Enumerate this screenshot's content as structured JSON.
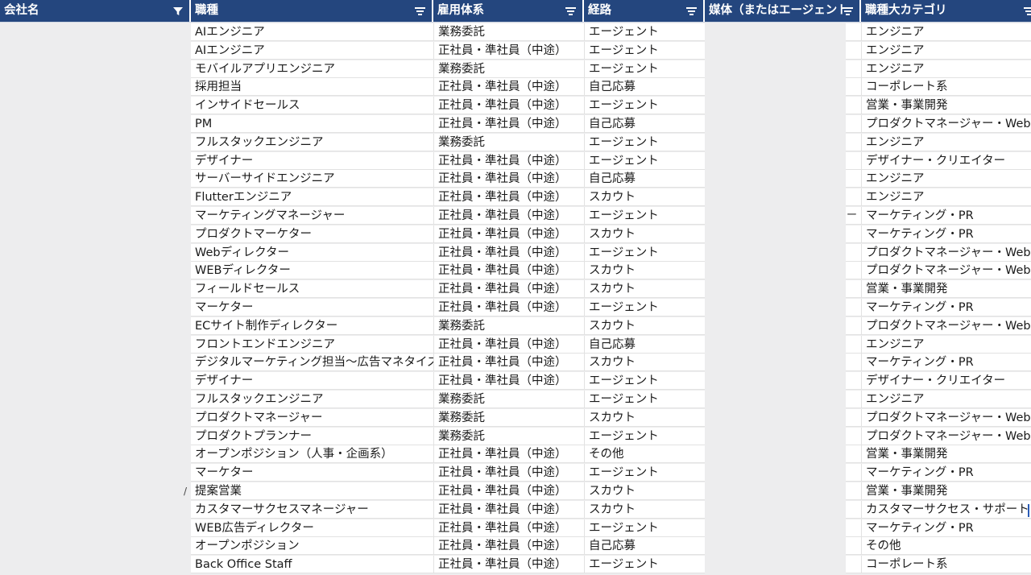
{
  "headers": [
    {
      "label": "会社名",
      "filter": "funnel-solid"
    },
    {
      "label": "職種",
      "filter": "lines"
    },
    {
      "label": "雇用体系",
      "filter": "lines"
    },
    {
      "label": "経路",
      "filter": "lines"
    },
    {
      "label": "媒体（またはエージェント",
      "filter": "lines"
    },
    {
      "label": "職種大カテゴリ",
      "filter": "lines"
    }
  ],
  "colors": {
    "header_bg": "#24467e",
    "header_text": "#ffffff",
    "cell_bg": "#ffffff",
    "grid": "#e2e2e2",
    "sheet_bg": "#ededee"
  },
  "rows": [
    {
      "role": "AIエンジニア",
      "employment": "業務委託",
      "route": "エージェント",
      "media": "",
      "category": "エンジニア"
    },
    {
      "role": "AIエンジニア",
      "employment": "正社員・準社員（中途）",
      "route": "エージェント",
      "media": "",
      "category": "エンジニア"
    },
    {
      "role": "モバイルアプリエンジニア",
      "employment": "業務委託",
      "route": "エージェント",
      "media": "",
      "category": "エンジニア"
    },
    {
      "role": "採用担当",
      "employment": "正社員・準社員（中途）",
      "route": "自己応募",
      "media": "",
      "category": "コーポレート系"
    },
    {
      "role": "インサイドセールス",
      "employment": "正社員・準社員（中途）",
      "route": "エージェント",
      "media": "",
      "category": "営業・事業開発"
    },
    {
      "role": "PM",
      "employment": "正社員・準社員（中途）",
      "route": "自己応募",
      "media": "",
      "category": "プロダクトマネージャー・Webデ"
    },
    {
      "role": "フルスタックエンジニア",
      "employment": "業務委託",
      "route": "エージェント",
      "media": "",
      "category": "エンジニア"
    },
    {
      "role": "デザイナー",
      "employment": "正社員・準社員（中途）",
      "route": "エージェント",
      "media": "",
      "category": "デザイナー・クリエイター"
    },
    {
      "role": "サーバーサイドエンジニア",
      "employment": "正社員・準社員（中途）",
      "route": "自己応募",
      "media": "",
      "category": "エンジニア"
    },
    {
      "role": "Flutterエンジニア",
      "employment": "正社員・準社員（中途）",
      "route": "スカウト",
      "media": "",
      "category": "エンジニア"
    },
    {
      "role": "マーケティングマネージャー",
      "employment": "正社員・準社員（中途）",
      "route": "エージェント",
      "media": "ー",
      "category": "マーケティング・PR"
    },
    {
      "role": "プロダクトマーケター",
      "employment": "正社員・準社員（中途）",
      "route": "スカウト",
      "media": "",
      "category": "マーケティング・PR"
    },
    {
      "role": "Webディレクター",
      "employment": "正社員・準社員（中途）",
      "route": "エージェント",
      "media": "",
      "category": "プロダクトマネージャー・Webデ"
    },
    {
      "role": "WEBディレクター",
      "employment": "正社員・準社員（中途）",
      "route": "スカウト",
      "media": "",
      "category": "プロダクトマネージャー・Webデ"
    },
    {
      "role": "フィールドセールス",
      "employment": "正社員・準社員（中途）",
      "route": "スカウト",
      "media": "",
      "category": "営業・事業開発"
    },
    {
      "role": "マーケター",
      "employment": "正社員・準社員（中途）",
      "route": "エージェント",
      "media": "",
      "category": "マーケティング・PR"
    },
    {
      "role": "ECサイト制作ディレクター",
      "employment": "業務委託",
      "route": "スカウト",
      "media": "",
      "category": "プロダクトマネージャー・Webデ"
    },
    {
      "role": "フロントエンドエンジニア",
      "employment": "正社員・準社員（中途）",
      "route": "自己応募",
      "media": "",
      "category": "エンジニア"
    },
    {
      "role": "デジタルマーケティング担当〜広告マネタイズ",
      "employment": "正社員・準社員（中途）",
      "route": "スカウト",
      "media": "",
      "category": "マーケティング・PR"
    },
    {
      "role": "デザイナー",
      "employment": "正社員・準社員（中途）",
      "route": "エージェント",
      "media": "",
      "category": "デザイナー・クリエイター"
    },
    {
      "role": "フルスタックエンジニア",
      "employment": "業務委託",
      "route": "エージェント",
      "media": "",
      "category": "エンジニア"
    },
    {
      "role": "プロダクトマネージャー",
      "employment": "業務委託",
      "route": "スカウト",
      "media": "",
      "category": "プロダクトマネージャー・Webデ"
    },
    {
      "role": "プロダクトプランナー",
      "employment": "業務委託",
      "route": "エージェント",
      "media": "",
      "category": "プロダクトマネージャー・Webデ"
    },
    {
      "role": "オープンポジション（人事・企画系）",
      "employment": "正社員・準社員（中途）",
      "route": "その他",
      "media": "",
      "category": "営業・事業開発"
    },
    {
      "role": "マーケター",
      "employment": "正社員・準社員（中途）",
      "route": "エージェント",
      "media": "",
      "category": "マーケティング・PR"
    },
    {
      "role": "提案営業",
      "employment": "正社員・準社員（中途）",
      "route": "スカウト",
      "media": "",
      "category": "営業・事業開発",
      "left_mark": "/"
    },
    {
      "role": "カスタマーサクセスマネージャー",
      "employment": "正社員・準社員（中途）",
      "route": "スカウト",
      "media": "",
      "category": "カスタマーサクセス・サポート"
    },
    {
      "role": "WEB広告ディレクター",
      "employment": "正社員・準社員（中途）",
      "route": "エージェント",
      "media": "",
      "category": "マーケティング・PR"
    },
    {
      "role": "オープンポジション",
      "employment": "正社員・準社員（中途）",
      "route": "自己応募",
      "media": "",
      "category": "その他"
    },
    {
      "role": "Back Office Staff",
      "employment": "正社員・準社員（中途）",
      "route": "エージェント",
      "media": "",
      "category": "コーポレート系"
    }
  ]
}
